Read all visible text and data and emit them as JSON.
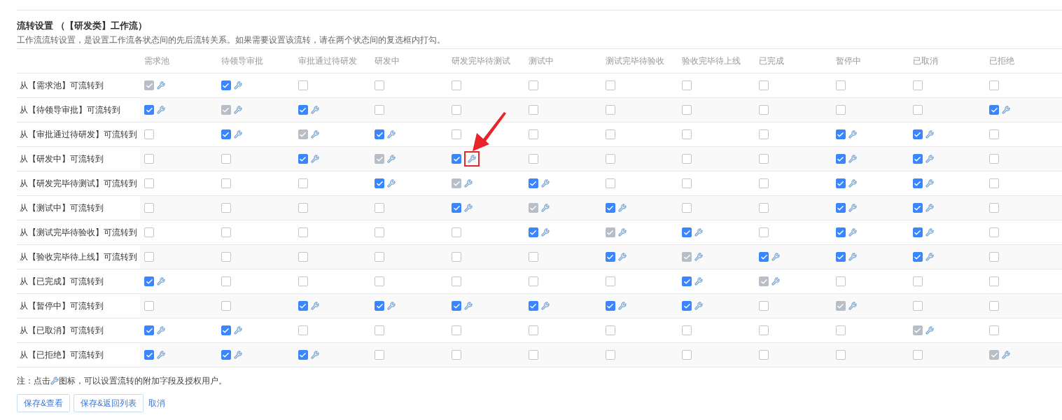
{
  "section": {
    "title": "流转设置 （【研发类】工作流）",
    "description": "工作流流转设置，是设置工作流各状态间的先后流转关系。如果需要设置该流转，请在两个状态间的复选框内打勾。"
  },
  "table": {
    "columns": [
      "需求池",
      "待领导审批",
      "审批通过待研发",
      "研发中",
      "研发完毕待测试",
      "测试中",
      "测试完毕待验收",
      "验收完毕待上线",
      "已完成",
      "暂停中",
      "已取消",
      "已拒绝"
    ],
    "rows": [
      {
        "label": "从【需求池】可流转到",
        "cells": [
          {
            "checked": true,
            "disabled": true
          },
          {
            "checked": true,
            "disabled": false
          },
          {
            "checked": false,
            "disabled": false
          },
          {
            "checked": false,
            "disabled": false
          },
          {
            "checked": false,
            "disabled": false
          },
          {
            "checked": false,
            "disabled": false
          },
          {
            "checked": false,
            "disabled": false
          },
          {
            "checked": false,
            "disabled": false
          },
          {
            "checked": false,
            "disabled": false
          },
          {
            "checked": false,
            "disabled": false
          },
          {
            "checked": false,
            "disabled": false
          },
          {
            "checked": false,
            "disabled": false
          }
        ]
      },
      {
        "label": "从【待领导审批】可流转到",
        "cells": [
          {
            "checked": true,
            "disabled": false
          },
          {
            "checked": true,
            "disabled": true
          },
          {
            "checked": true,
            "disabled": false
          },
          {
            "checked": false,
            "disabled": false
          },
          {
            "checked": false,
            "disabled": false
          },
          {
            "checked": false,
            "disabled": false
          },
          {
            "checked": false,
            "disabled": false
          },
          {
            "checked": false,
            "disabled": false
          },
          {
            "checked": false,
            "disabled": false
          },
          {
            "checked": false,
            "disabled": false
          },
          {
            "checked": false,
            "disabled": false
          },
          {
            "checked": true,
            "disabled": false
          }
        ]
      },
      {
        "label": "从【审批通过待研发】可流转到",
        "cells": [
          {
            "checked": false,
            "disabled": false
          },
          {
            "checked": true,
            "disabled": false
          },
          {
            "checked": true,
            "disabled": true
          },
          {
            "checked": true,
            "disabled": false
          },
          {
            "checked": false,
            "disabled": false
          },
          {
            "checked": false,
            "disabled": false
          },
          {
            "checked": false,
            "disabled": false
          },
          {
            "checked": false,
            "disabled": false
          },
          {
            "checked": false,
            "disabled": false
          },
          {
            "checked": true,
            "disabled": false
          },
          {
            "checked": true,
            "disabled": false
          },
          {
            "checked": false,
            "disabled": false
          }
        ]
      },
      {
        "label": "从【研发中】可流转到",
        "cells": [
          {
            "checked": false,
            "disabled": false
          },
          {
            "checked": false,
            "disabled": false
          },
          {
            "checked": true,
            "disabled": false
          },
          {
            "checked": true,
            "disabled": true
          },
          {
            "checked": true,
            "disabled": false,
            "annotated": true
          },
          {
            "checked": false,
            "disabled": false
          },
          {
            "checked": false,
            "disabled": false
          },
          {
            "checked": false,
            "disabled": false
          },
          {
            "checked": false,
            "disabled": false
          },
          {
            "checked": true,
            "disabled": false
          },
          {
            "checked": true,
            "disabled": false
          },
          {
            "checked": false,
            "disabled": false
          }
        ]
      },
      {
        "label": "从【研发完毕待测试】可流转到",
        "cells": [
          {
            "checked": false,
            "disabled": false
          },
          {
            "checked": false,
            "disabled": false
          },
          {
            "checked": false,
            "disabled": false
          },
          {
            "checked": true,
            "disabled": false
          },
          {
            "checked": true,
            "disabled": true
          },
          {
            "checked": true,
            "disabled": false
          },
          {
            "checked": false,
            "disabled": false
          },
          {
            "checked": false,
            "disabled": false
          },
          {
            "checked": false,
            "disabled": false
          },
          {
            "checked": true,
            "disabled": false
          },
          {
            "checked": true,
            "disabled": false
          },
          {
            "checked": false,
            "disabled": false
          }
        ]
      },
      {
        "label": "从【测试中】可流转到",
        "cells": [
          {
            "checked": false,
            "disabled": false
          },
          {
            "checked": false,
            "disabled": false
          },
          {
            "checked": false,
            "disabled": false
          },
          {
            "checked": false,
            "disabled": false
          },
          {
            "checked": true,
            "disabled": false
          },
          {
            "checked": true,
            "disabled": true
          },
          {
            "checked": true,
            "disabled": false
          },
          {
            "checked": false,
            "disabled": false
          },
          {
            "checked": false,
            "disabled": false
          },
          {
            "checked": true,
            "disabled": false
          },
          {
            "checked": true,
            "disabled": false
          },
          {
            "checked": false,
            "disabled": false
          }
        ]
      },
      {
        "label": "从【测试完毕待验收】可流转到",
        "cells": [
          {
            "checked": false,
            "disabled": false
          },
          {
            "checked": false,
            "disabled": false
          },
          {
            "checked": false,
            "disabled": false
          },
          {
            "checked": false,
            "disabled": false
          },
          {
            "checked": false,
            "disabled": false
          },
          {
            "checked": true,
            "disabled": false
          },
          {
            "checked": true,
            "disabled": true
          },
          {
            "checked": true,
            "disabled": false
          },
          {
            "checked": false,
            "disabled": false
          },
          {
            "checked": true,
            "disabled": false
          },
          {
            "checked": true,
            "disabled": false
          },
          {
            "checked": false,
            "disabled": false
          }
        ]
      },
      {
        "label": "从【验收完毕待上线】可流转到",
        "cells": [
          {
            "checked": false,
            "disabled": false
          },
          {
            "checked": false,
            "disabled": false
          },
          {
            "checked": false,
            "disabled": false
          },
          {
            "checked": false,
            "disabled": false
          },
          {
            "checked": false,
            "disabled": false
          },
          {
            "checked": false,
            "disabled": false
          },
          {
            "checked": true,
            "disabled": false
          },
          {
            "checked": true,
            "disabled": true
          },
          {
            "checked": true,
            "disabled": false
          },
          {
            "checked": true,
            "disabled": false
          },
          {
            "checked": true,
            "disabled": false
          },
          {
            "checked": false,
            "disabled": false
          }
        ]
      },
      {
        "label": "从【已完成】可流转到",
        "cells": [
          {
            "checked": true,
            "disabled": false
          },
          {
            "checked": false,
            "disabled": false
          },
          {
            "checked": false,
            "disabled": false
          },
          {
            "checked": false,
            "disabled": false
          },
          {
            "checked": false,
            "disabled": false
          },
          {
            "checked": false,
            "disabled": false
          },
          {
            "checked": false,
            "disabled": false
          },
          {
            "checked": true,
            "disabled": false
          },
          {
            "checked": true,
            "disabled": true
          },
          {
            "checked": false,
            "disabled": false
          },
          {
            "checked": false,
            "disabled": false
          },
          {
            "checked": false,
            "disabled": false
          }
        ]
      },
      {
        "label": "从【暂停中】可流转到",
        "cells": [
          {
            "checked": false,
            "disabled": false
          },
          {
            "checked": false,
            "disabled": false
          },
          {
            "checked": true,
            "disabled": false
          },
          {
            "checked": true,
            "disabled": false
          },
          {
            "checked": true,
            "disabled": false
          },
          {
            "checked": true,
            "disabled": false
          },
          {
            "checked": true,
            "disabled": false
          },
          {
            "checked": true,
            "disabled": false
          },
          {
            "checked": false,
            "disabled": false
          },
          {
            "checked": true,
            "disabled": true
          },
          {
            "checked": false,
            "disabled": false
          },
          {
            "checked": false,
            "disabled": false
          }
        ]
      },
      {
        "label": "从【已取消】可流转到",
        "cells": [
          {
            "checked": true,
            "disabled": false
          },
          {
            "checked": true,
            "disabled": false
          },
          {
            "checked": false,
            "disabled": false
          },
          {
            "checked": false,
            "disabled": false
          },
          {
            "checked": false,
            "disabled": false
          },
          {
            "checked": false,
            "disabled": false
          },
          {
            "checked": false,
            "disabled": false
          },
          {
            "checked": false,
            "disabled": false
          },
          {
            "checked": false,
            "disabled": false
          },
          {
            "checked": false,
            "disabled": false
          },
          {
            "checked": true,
            "disabled": true
          },
          {
            "checked": false,
            "disabled": false
          }
        ]
      },
      {
        "label": "从【已拒绝】可流转到",
        "cells": [
          {
            "checked": true,
            "disabled": false
          },
          {
            "checked": true,
            "disabled": false
          },
          {
            "checked": true,
            "disabled": false
          },
          {
            "checked": false,
            "disabled": false
          },
          {
            "checked": false,
            "disabled": false
          },
          {
            "checked": false,
            "disabled": false
          },
          {
            "checked": false,
            "disabled": false
          },
          {
            "checked": false,
            "disabled": false
          },
          {
            "checked": false,
            "disabled": false
          },
          {
            "checked": false,
            "disabled": false
          },
          {
            "checked": false,
            "disabled": false
          },
          {
            "checked": true,
            "disabled": true
          }
        ]
      }
    ]
  },
  "note": {
    "before": "注：点击",
    "after": "图标，可以设置流转的附加字段及授权用户。"
  },
  "buttons": [
    {
      "label": "保存&查看",
      "kind": "button"
    },
    {
      "label": "保存&返回列表",
      "kind": "button"
    },
    {
      "label": "取消",
      "kind": "link"
    }
  ]
}
